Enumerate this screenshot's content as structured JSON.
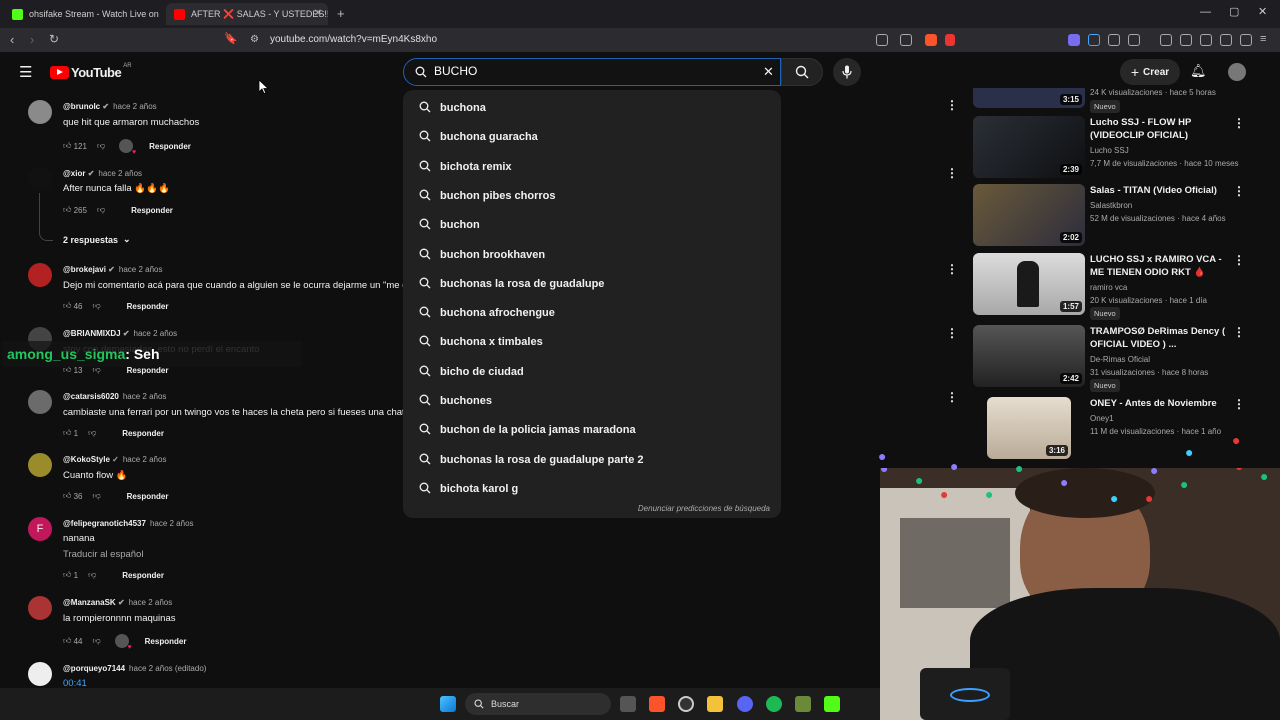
{
  "browser": {
    "tabs": [
      {
        "title": "ohsifake Stream - Watch Live on",
        "favicon_color": "#53fc18"
      },
      {
        "title": "AFTER ❌ SALAS - Y USTEDES!!",
        "favicon_color": "#ff0000"
      }
    ],
    "url": "youtube.com/watch?v=mEyn4Ks8xho"
  },
  "youtube": {
    "logo_text": "YouTube",
    "region": "AR",
    "search_query": "BUCHO",
    "create_label": "Crear"
  },
  "suggestions": [
    "buchona",
    "buchona guaracha",
    "bichota remix",
    "buchon pibes chorros",
    "buchon",
    "buchon brookhaven",
    "buchonas la rosa de guadalupe",
    "buchona afrochengue",
    "buchona x timbales",
    "bicho de ciudad",
    "buchones",
    "buchon de la policia jamas maradona",
    "buchonas la rosa de guadalupe parte 2",
    "bichota karol g"
  ],
  "report_text": "Denunciar predicciones de búsqueda",
  "comments": [
    {
      "author": "@brunolc",
      "when": "hace 2 años",
      "text": "que hit que armaron muchachos",
      "likes": "121",
      "reply": "Responder",
      "verified": true,
      "avatar_color": "#8a8a8a"
    },
    {
      "author": "@xior",
      "when": "hace 2 años",
      "text": "After nunca falla 🔥🔥🔥",
      "likes": "265",
      "reply": "Responder",
      "verified": true,
      "avatar_color": "#111111"
    },
    {
      "author": "@brokejavi",
      "when": "hace 2 años",
      "text": "Dejo mi comentario acá para que cuando a alguien se le ocurra dejarme un \"me gu",
      "likes": "46",
      "reply": "Responder",
      "verified": true,
      "avatar_color": "#b22222"
    },
    {
      "author": "@BRIANMIXDJ",
      "when": "hace 2 años",
      "text": "stoy con demasiadas. esto no perdí el encanto",
      "likes": "13",
      "reply": "Responder",
      "verified": true,
      "avatar_color": "#444444"
    },
    {
      "author": "@catarsis6020",
      "when": "hace 2 años",
      "text": "cambiaste una ferrari por un twingo vos te haces la cheta pero si fueses una chata",
      "likes": "1",
      "reply": "Responder",
      "verified": false,
      "avatar_color": "#6b6b6b"
    },
    {
      "author": "@KokoStyle",
      "when": "hace 2 años",
      "text": "Cuanto flow 🔥",
      "likes": "36",
      "reply": "Responder",
      "verified": true,
      "avatar_color": "#9a8c2a"
    },
    {
      "author": "@felipegranotich4537",
      "when": "hace 2 años",
      "text": "nanana",
      "likes": "1",
      "reply": "Responder",
      "verified": false,
      "avatar_color": "#c2185b",
      "translate": "Traducir al español",
      "initial": "F"
    },
    {
      "author": "@ManzanaSK",
      "when": "hace 2 años",
      "text": "la rompieronnnn maquinas",
      "likes": "44",
      "reply": "Responder",
      "verified": true,
      "avatar_color": "#a33"
    },
    {
      "author": "@porqueyo7144",
      "when": "hace 2 años (editado)",
      "text": "00:41",
      "likes": "",
      "reply": "",
      "verified": false,
      "avatar_color": "#eee"
    }
  ],
  "replies_toggle": "2 respuestas",
  "chat_overlay": {
    "user": "among_us_sigma",
    "message": ": Seh",
    "user_color": "#22c55e"
  },
  "sidebar": [
    {
      "title": "",
      "channel": "",
      "meta": "24 K visualizaciones · hace 5 horas",
      "duration": "3:15",
      "nuevo": "Nuevo",
      "thumb_color": "#2a2f4a"
    },
    {
      "title": "Lucho SSJ - FLOW HP (VIDEOCLIP OFICIAL)",
      "channel": "Lucho SSJ",
      "meta": "7,7 M de visualizaciones · hace 10 meses",
      "duration": "2:39",
      "thumb_color": "#1f2328"
    },
    {
      "title": "Salas - TITAN (Video Oficial)",
      "channel": "Salastkbron",
      "meta": "52 M de visualizaciones · hace 4 años",
      "duration": "2:02",
      "thumb_color": "#5a4a3a"
    },
    {
      "title": "LUCHO SSJ x RAMIRO VCA - ME TIENEN ODIO RKT 🩸",
      "channel": "ramiro vca",
      "meta": "20 K visualizaciones · hace 1 día",
      "duration": "1:57",
      "nuevo": "Nuevo",
      "thumb_color": "#cfcfcf"
    },
    {
      "title": "TRAMPOSØ DeRimas Dency ( OFICIAL VIDEO ) ...",
      "channel": "De-Rimas Oficial",
      "meta": "31 visualizaciones · hace 8 horas",
      "duration": "2:42",
      "nuevo": "Nuevo",
      "thumb_color": "#3c3c3c"
    },
    {
      "title": "ONEY - Antes de Noviembre",
      "channel": "Oney1",
      "meta": "11 M de visualizaciones · hace 1 año",
      "duration": "3:16",
      "thumb_color": "#d9d0c2"
    }
  ],
  "taskbar": {
    "search_label": "Buscar"
  }
}
